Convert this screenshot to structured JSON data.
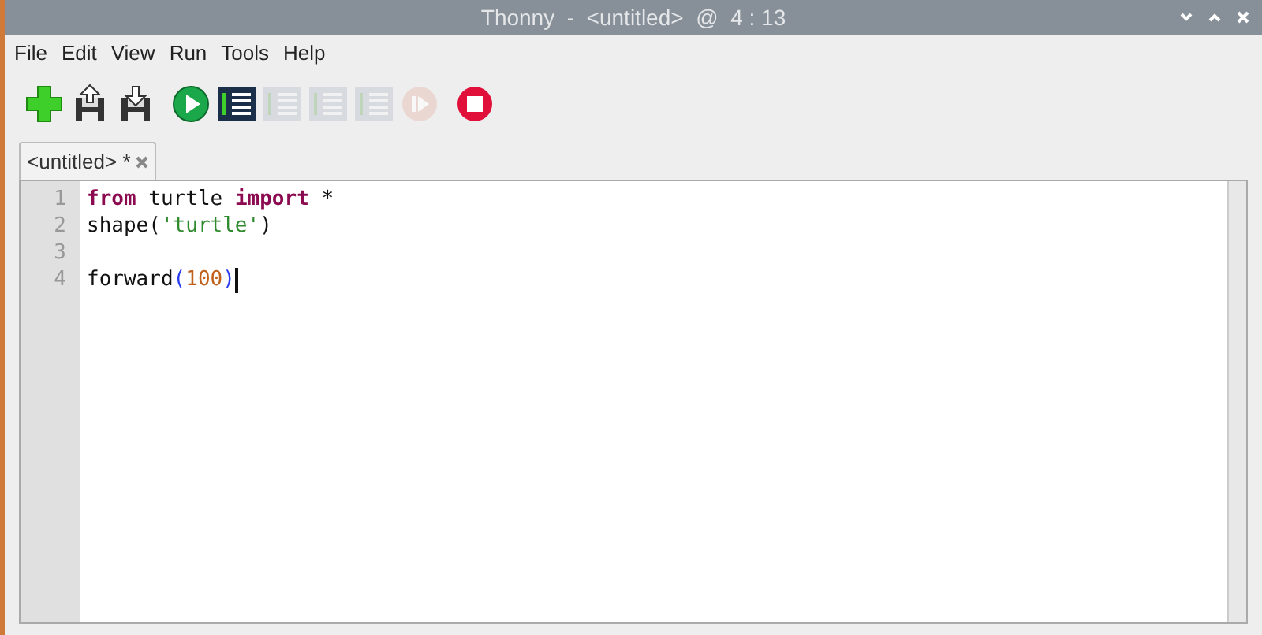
{
  "window": {
    "title": "Thonny  -  <untitled>  @  4 : 13"
  },
  "menu": [
    "File",
    "Edit",
    "View",
    "Run",
    "Tools",
    "Help"
  ],
  "toolbar": [
    {
      "kind": "new",
      "disabled": false
    },
    {
      "kind": "load",
      "disabled": false
    },
    {
      "kind": "save",
      "disabled": false
    },
    {
      "kind": "run",
      "disabled": false
    },
    {
      "kind": "debug",
      "disabled": false
    },
    {
      "kind": "step-over",
      "disabled": true
    },
    {
      "kind": "step-into",
      "disabled": true
    },
    {
      "kind": "step-out",
      "disabled": true
    },
    {
      "kind": "resume",
      "disabled": true
    },
    {
      "kind": "stop",
      "disabled": false
    }
  ],
  "tabs": [
    {
      "label": "<untitled> *",
      "selected": true
    }
  ],
  "editor": {
    "lines": [
      {
        "number": "1",
        "tokens": [
          {
            "kind": "keyword",
            "text": "from"
          },
          {
            "kind": "plain",
            "text": " turtle "
          },
          {
            "kind": "keyword",
            "text": "import"
          },
          {
            "kind": "plain",
            "text": " *"
          }
        ]
      },
      {
        "number": "2",
        "tokens": [
          {
            "kind": "plain",
            "text": "shape("
          },
          {
            "kind": "string",
            "text": "'turtle'"
          },
          {
            "kind": "plain",
            "text": ")"
          }
        ]
      },
      {
        "number": "3"
      },
      {
        "number": "4",
        "tokens": [
          {
            "kind": "plain",
            "text": "forward"
          },
          {
            "kind": "paren",
            "text": "("
          },
          {
            "kind": "number",
            "text": "100"
          },
          {
            "kind": "paren",
            "text": ")"
          }
        ],
        "cursor": true
      }
    ]
  }
}
